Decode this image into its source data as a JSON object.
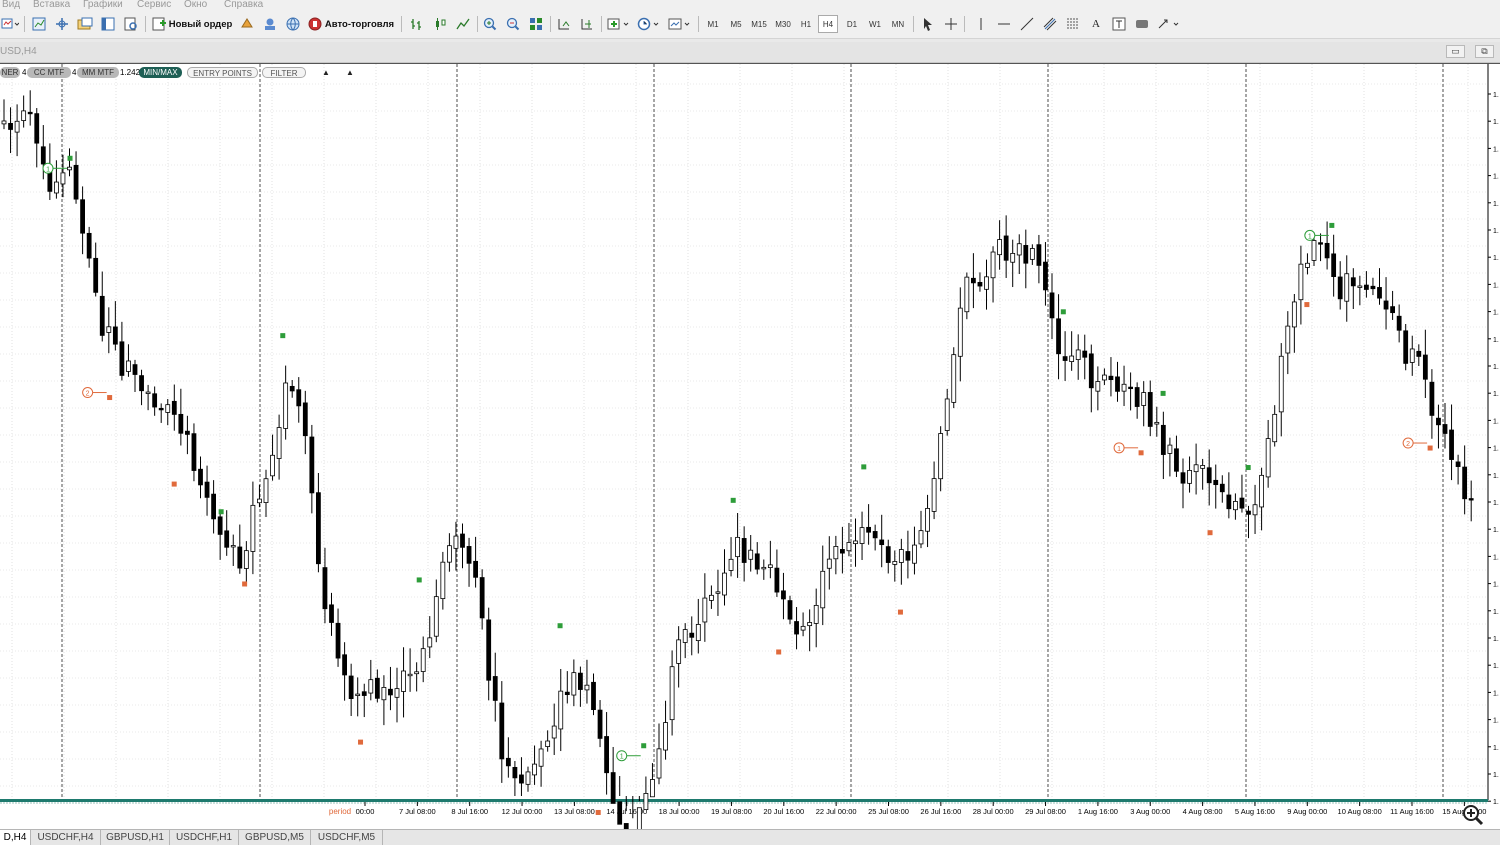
{
  "menu": [
    "Вид",
    "Вставка",
    "Графики",
    "Сервис",
    "Окно",
    "Справка"
  ],
  "toolbar": {
    "new_order": "Новый ордер",
    "auto_trading": "Авто-торговля",
    "timeframes": [
      "M1",
      "M5",
      "M15",
      "M30",
      "H1",
      "H4",
      "D1",
      "W1",
      "MN"
    ],
    "active_timeframe": "H4",
    "text_tool": "A"
  },
  "window": {
    "title": "USD,H4"
  },
  "panel": {
    "buttons": [
      "NER",
      "CC MTF",
      "MM MTF",
      "MIN/MAX",
      "ENTRY POINTS",
      "FILTER"
    ],
    "value": "1.242",
    "sep_num": "4"
  },
  "colors": {
    "up_signal": "#2e9d3a",
    "down_signal": "#e06a3c",
    "period_sep": "#1e7a6e",
    "active_button": "#1e5f55"
  },
  "chart_data": {
    "type": "candlestick",
    "symbol": "GBPUSD",
    "timeframe": "H4",
    "x_labels": [
      "00:00",
      "7 Jul 08:00",
      "8 Jul 16:00",
      "12 Jul 00:00",
      "13 Jul 08:00",
      "14 Jul 16:00",
      "18 Jul 00:00",
      "19 Jul 08:00",
      "20 Jul 16:00",
      "22 Jul 00:00",
      "25 Jul 08:00",
      "26 Jul 16:00",
      "28 Jul 00:00",
      "29 Jul 08:00",
      "1 Aug 16:00",
      "3 Aug 00:00",
      "4 Aug 08:00",
      "5 Aug 16:00",
      "9 Aug 00:00",
      "10 Aug 08:00",
      "11 Aug 16:00",
      "15 Aug 00:00"
    ],
    "x_axis_tag": "period",
    "y_axis_ticks": [
      "1.",
      "1.",
      "1.",
      "1.",
      "1.",
      "1.",
      "1.",
      "1.",
      "1.",
      "1.",
      "1.",
      "1.",
      "1.",
      "1.",
      "1.",
      "1.",
      "1.",
      "1.",
      "1.",
      "1.",
      "1.",
      "1.",
      "1.",
      "1.",
      "1.",
      "1.",
      "1."
    ],
    "price_path": [
      42,
      118,
      280,
      360,
      490,
      305,
      625,
      595,
      440,
      720,
      590,
      770,
      560,
      470,
      540,
      430,
      490,
      215,
      160,
      300,
      325,
      395,
      440,
      180,
      210,
      300,
      440
    ],
    "candle_spacing": 6.55,
    "signals": [
      {
        "type": "max",
        "num": "1",
        "t": 0.045
      },
      {
        "type": "min",
        "num": "2",
        "t": 0.072
      },
      {
        "type": "max",
        "num": "",
        "t": 0.148
      },
      {
        "type": "min",
        "num": "",
        "t": 0.116
      },
      {
        "type": "max",
        "num": "",
        "t": 0.19
      },
      {
        "type": "min",
        "num": "",
        "t": 0.164
      },
      {
        "type": "min",
        "num": "",
        "t": 0.243
      },
      {
        "type": "max",
        "num": "",
        "t": 0.283
      },
      {
        "type": "min",
        "num": "",
        "t": 0.344
      },
      {
        "type": "max",
        "num": "",
        "t": 0.379
      },
      {
        "type": "min",
        "num": "",
        "t": 0.405
      },
      {
        "type": "max",
        "num": "1",
        "t": 0.436
      },
      {
        "type": "max",
        "num": "",
        "t": 0.497
      },
      {
        "type": "min",
        "num": "",
        "t": 0.528
      },
      {
        "type": "max",
        "num": "",
        "t": 0.586
      },
      {
        "type": "min",
        "num": "",
        "t": 0.611
      },
      {
        "type": "max",
        "num": "",
        "t": 0.722
      },
      {
        "type": "min",
        "num": "1",
        "t": 0.775
      },
      {
        "type": "max",
        "num": "",
        "t": 0.79
      },
      {
        "type": "min",
        "num": "",
        "t": 0.822
      },
      {
        "type": "max",
        "num": "",
        "t": 0.848
      },
      {
        "type": "min",
        "num": "",
        "t": 0.888
      },
      {
        "type": "max",
        "num": "1",
        "t": 0.905
      },
      {
        "type": "min",
        "num": "2",
        "t": 0.972
      }
    ]
  },
  "tabs": [
    "D,H4",
    "USDCHF,H4",
    "GBPUSD,H1",
    "USDCHF,H1",
    "GBPUSD,M5",
    "USDCHF,M5"
  ]
}
